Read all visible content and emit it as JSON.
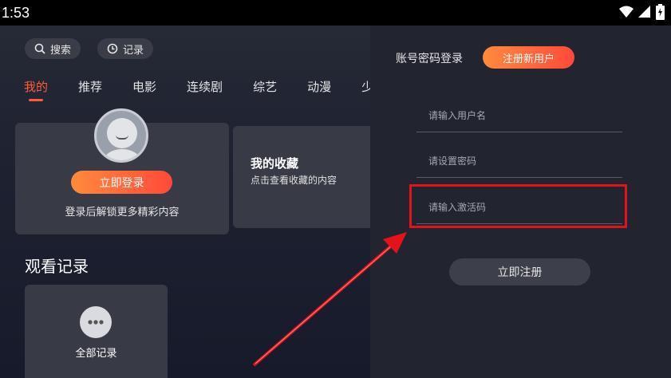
{
  "status_bar": {
    "time": "1:53",
    "icons": [
      "wifi-icon",
      "signal-icon",
      "battery-charging-icon"
    ]
  },
  "top_bar": {
    "search_label": "搜索",
    "history_label": "记录"
  },
  "tabs": [
    {
      "label": "我的",
      "active": true
    },
    {
      "label": "推荐"
    },
    {
      "label": "电影"
    },
    {
      "label": "连续剧"
    },
    {
      "label": "综艺"
    },
    {
      "label": "动漫"
    },
    {
      "label": "少"
    }
  ],
  "profile_card": {
    "login_button": "立即登录",
    "hint": "登录后解锁更多精彩内容"
  },
  "favorites_card": {
    "title": "我的收藏",
    "subtitle": "点击查看收藏的内容"
  },
  "history_section": {
    "title": "观看记录",
    "all_records_label": "全部记录"
  },
  "register_panel": {
    "account_login_tab": "账号密码登录",
    "register_tab": "注册新用户",
    "username_placeholder": "请输入用户名",
    "password_placeholder": "请设置密码",
    "activation_placeholder": "请输入激活码",
    "submit_button": "立即注册"
  },
  "colors": {
    "accent": "#ff5b3a",
    "highlight_box": "#e3121b",
    "arrow": "#e3121b"
  }
}
